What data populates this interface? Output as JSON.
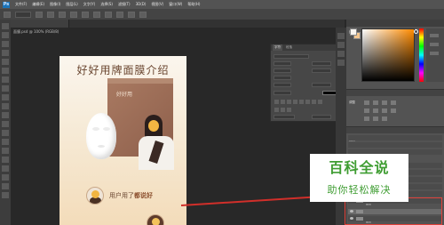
{
  "menu": {
    "logo": "Ps",
    "items": [
      "文件(F)",
      "编辑(E)",
      "图像(I)",
      "图层(L)",
      "文字(Y)",
      "选择(S)",
      "滤镜(T)",
      "3D(D)",
      "视图(V)",
      "窗口(W)",
      "帮助(H)"
    ]
  },
  "document": {
    "tab_label": "面膜.psd @ 100% (RGB/8)",
    "title": "好好用牌面膜介绍",
    "pouch_label": "好好用",
    "caption_prefix": "用户用了",
    "caption_emphasis": "都说好"
  },
  "character_panel": {
    "tab_character": "字符",
    "tab_paragraph": "段落"
  },
  "right_panel": {
    "color_tab": "颜色",
    "adjust_tab": "调整",
    "layers_tab": "图层",
    "layer_items": [
      "图层",
      "图层",
      "图层",
      "图层",
      "图层",
      "图层",
      "图层",
      "图层"
    ],
    "colors": {
      "foreground": "#f7f4ef",
      "background": "#f3c68f"
    }
  },
  "watermark": {
    "top": "百科全说",
    "bottom": "助你轻松解决"
  }
}
